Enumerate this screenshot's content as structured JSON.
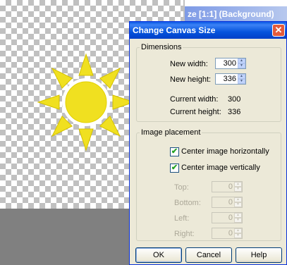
{
  "background_window": {
    "title": "ze [1:1] (Background)",
    "sun_color": "#f0e020"
  },
  "dialog": {
    "title": "Change Canvas Size",
    "close_glyph": "✕",
    "dimensions": {
      "legend": "Dimensions",
      "new_width_label": "New width:",
      "new_width_value": "300",
      "new_height_label": "New height:",
      "new_height_value": "336",
      "current_width_label": "Current width:",
      "current_width_value": "300",
      "current_height_label": "Current height:",
      "current_height_value": "336"
    },
    "placement": {
      "legend": "Image placement",
      "center_h_label": "Center image horizontally",
      "center_h_checked": true,
      "center_v_label": "Center image vertically",
      "center_v_checked": true,
      "top_label": "Top:",
      "top_value": "0",
      "bottom_label": "Bottom:",
      "bottom_value": "0",
      "left_label": "Left:",
      "left_value": "0",
      "right_label": "Right:",
      "right_value": "0"
    },
    "buttons": {
      "ok": "OK",
      "cancel": "Cancel",
      "help": "Help"
    },
    "check_glyph": "✔",
    "up_glyph": "▲",
    "down_glyph": "▼"
  }
}
